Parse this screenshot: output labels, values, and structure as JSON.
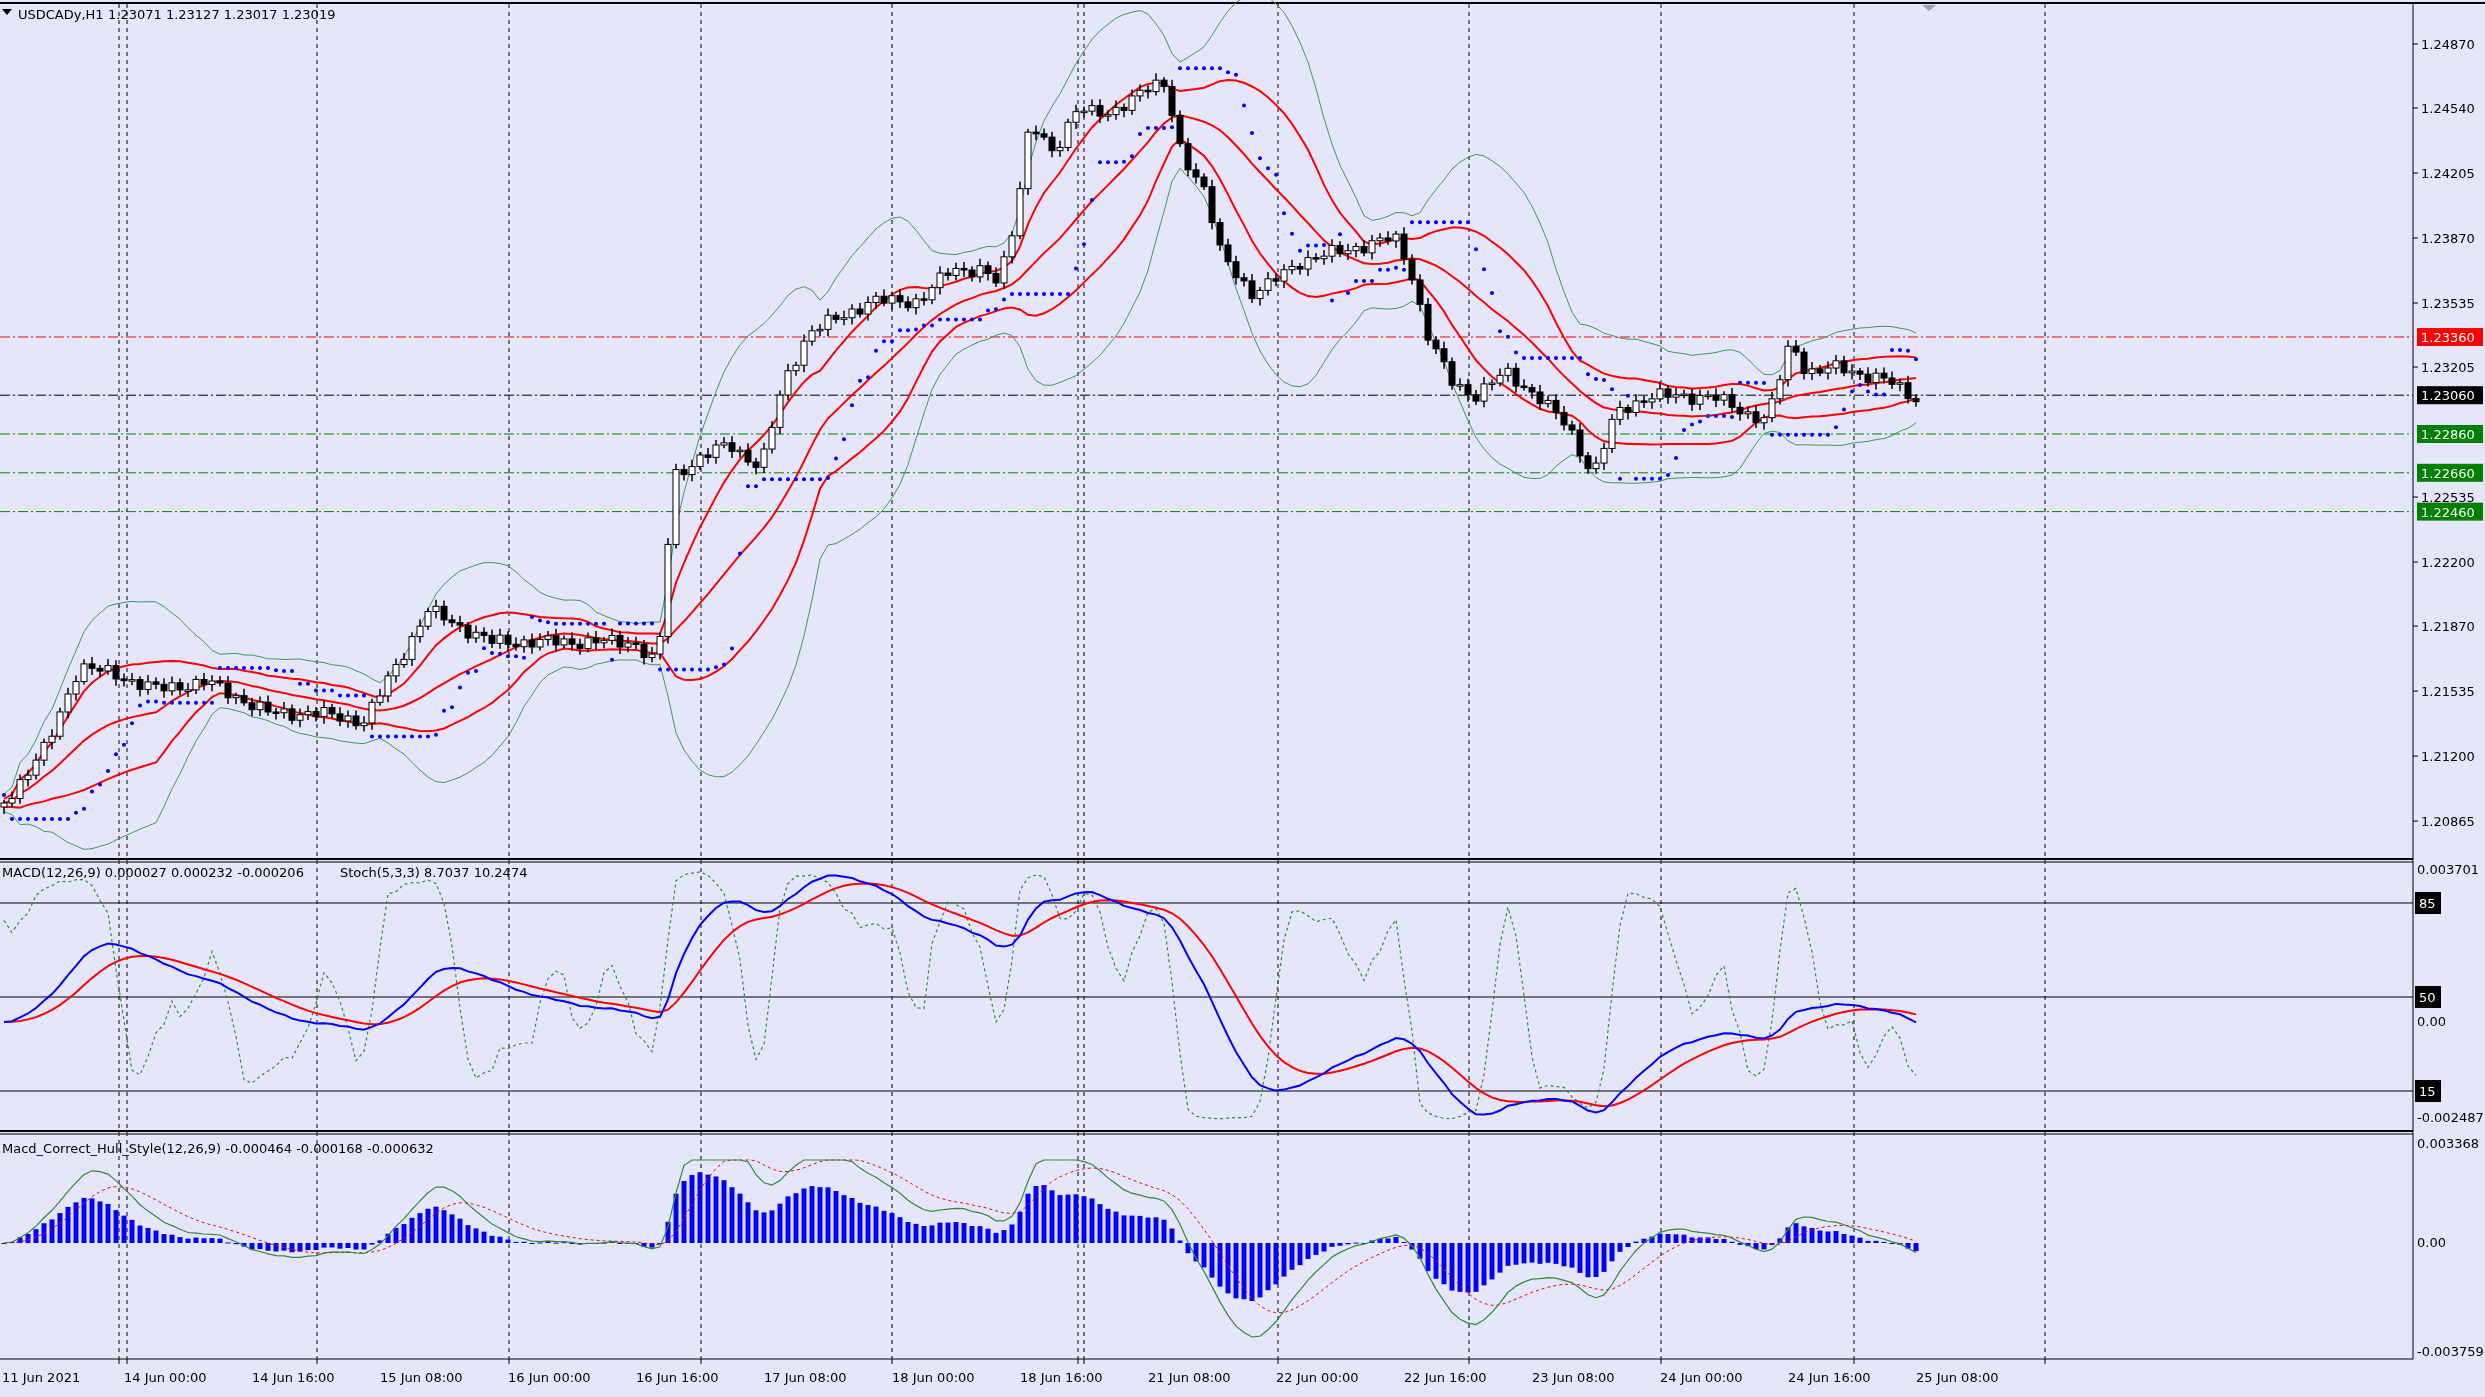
{
  "header": {
    "symbol": "USDCADy,H1",
    "ohlc": "1.23071 1.23127 1.23017 1.23019"
  },
  "price_axis": {
    "ticks": [
      "1.24870",
      "1.24540",
      "1.24205",
      "1.23870",
      "1.23535",
      "1.23205",
      "1.22535",
      "1.22200",
      "1.21870",
      "1.21535",
      "1.21200",
      "1.20865"
    ],
    "levels": [
      {
        "value": "1.23360",
        "color": "#ff0000"
      },
      {
        "value": "1.23060",
        "color": "#000000"
      },
      {
        "value": "1.22860",
        "color": "#008000"
      },
      {
        "value": "1.22660",
        "color": "#008000"
      },
      {
        "value": "1.22460",
        "color": "#008000"
      }
    ]
  },
  "macd_panel": {
    "macd_legend": "MACD(12,26,9) 0.000027 0.000232 -0.000206",
    "stoch_legend": "Stoch(5,3,3) 8.7037 10.2474",
    "axis_ticks": [
      "0.003701",
      "0.00",
      "-0.002487"
    ],
    "stoch_levels": [
      "85",
      "50",
      "15"
    ]
  },
  "hull_panel": {
    "legend": "Macd_Correct_Hull_Style(12,26,9) -0.000464 -0.000168 -0.000632",
    "axis_ticks": [
      "0.003368",
      "0.00",
      "-0.003759"
    ]
  },
  "time_axis": {
    "labels": [
      "11 Jun 2021",
      "14 Jun 00:00",
      "14 Jun 16:00",
      "15 Jun 08:00",
      "16 Jun 00:00",
      "16 Jun 16:00",
      "17 Jun 08:00",
      "18 Jun 00:00",
      "18 Jun 16:00",
      "21 Jun 08:00",
      "22 Jun 00:00",
      "22 Jun 16:00",
      "23 Jun 08:00",
      "24 Jun 00:00",
      "24 Jun 16:00",
      "25 Jun 08:00"
    ]
  }
}
